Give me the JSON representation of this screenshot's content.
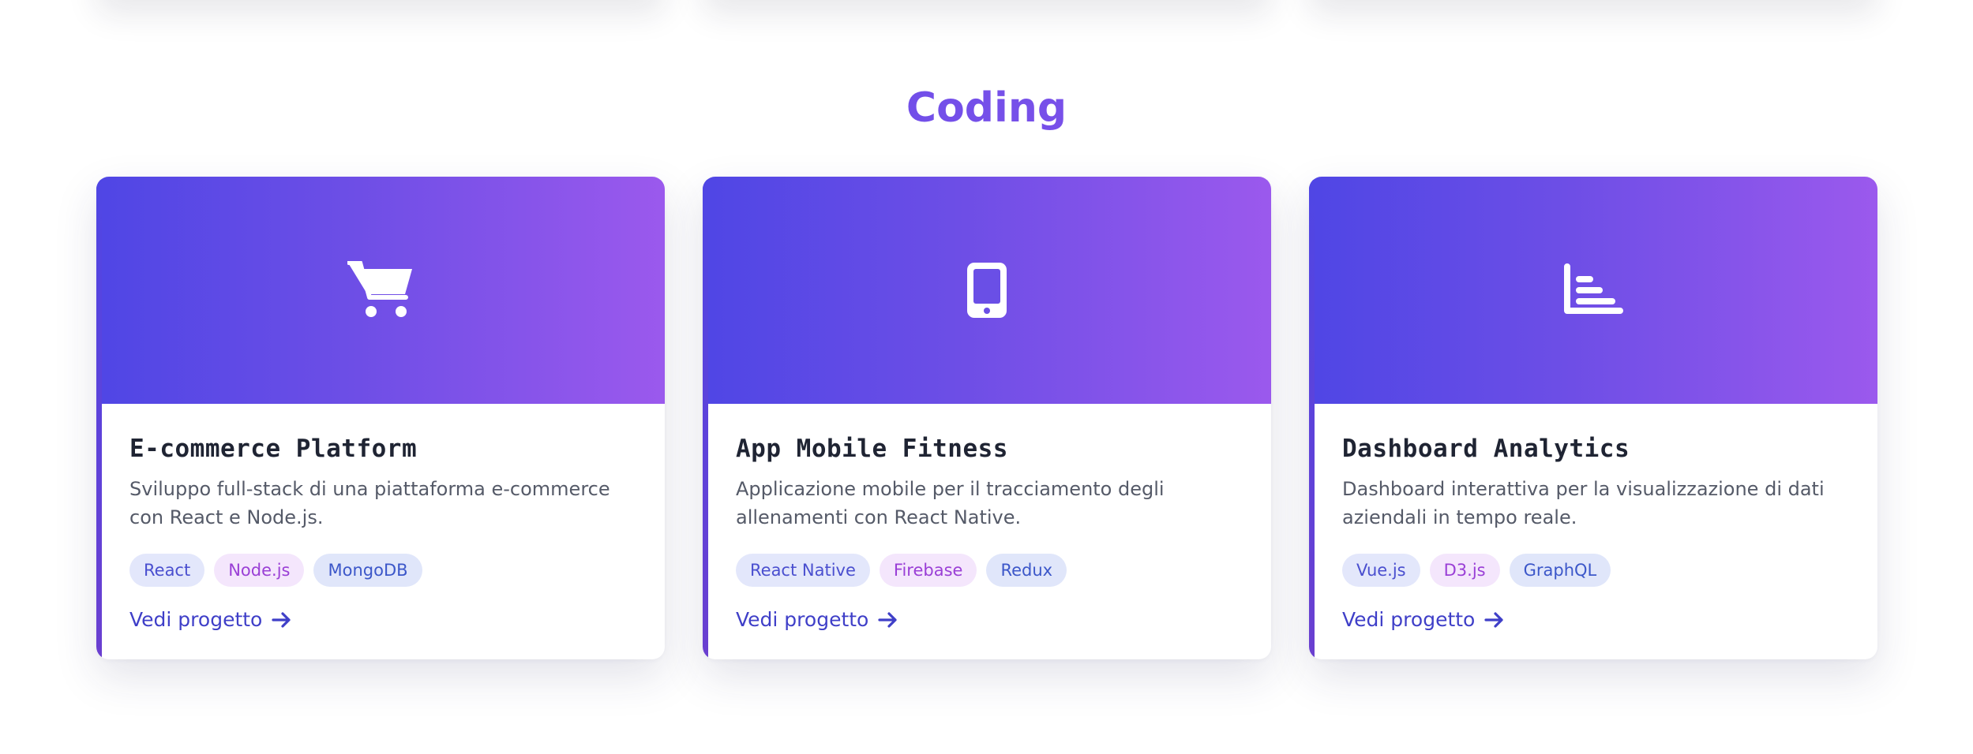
{
  "section": {
    "title": "Coding"
  },
  "colors": {
    "gradient_start": "#4f46e5",
    "gradient_end": "#9b59ed",
    "title_text": "#1f2433",
    "link_text": "#3f3fc8"
  },
  "projects": [
    {
      "icon": "shopping-cart-icon",
      "title": "E-commerce Platform",
      "description": "Sviluppo full-stack di una piattaforma e-commerce con React e Node.js.",
      "tags": [
        "React",
        "Node.js",
        "MongoDB"
      ],
      "link_label": "Vedi progetto"
    },
    {
      "icon": "mobile-phone-icon",
      "title": "App Mobile Fitness",
      "description": "Applicazione mobile per il tracciamento degli allenamenti con React Native.",
      "tags": [
        "React Native",
        "Firebase",
        "Redux"
      ],
      "link_label": "Vedi progetto"
    },
    {
      "icon": "bar-chart-icon",
      "title": "Dashboard Analytics",
      "description": "Dashboard interattiva per la visualizzazione di dati aziendali in tempo reale.",
      "tags": [
        "Vue.js",
        "D3.js",
        "GraphQL"
      ],
      "link_label": "Vedi progetto"
    }
  ]
}
